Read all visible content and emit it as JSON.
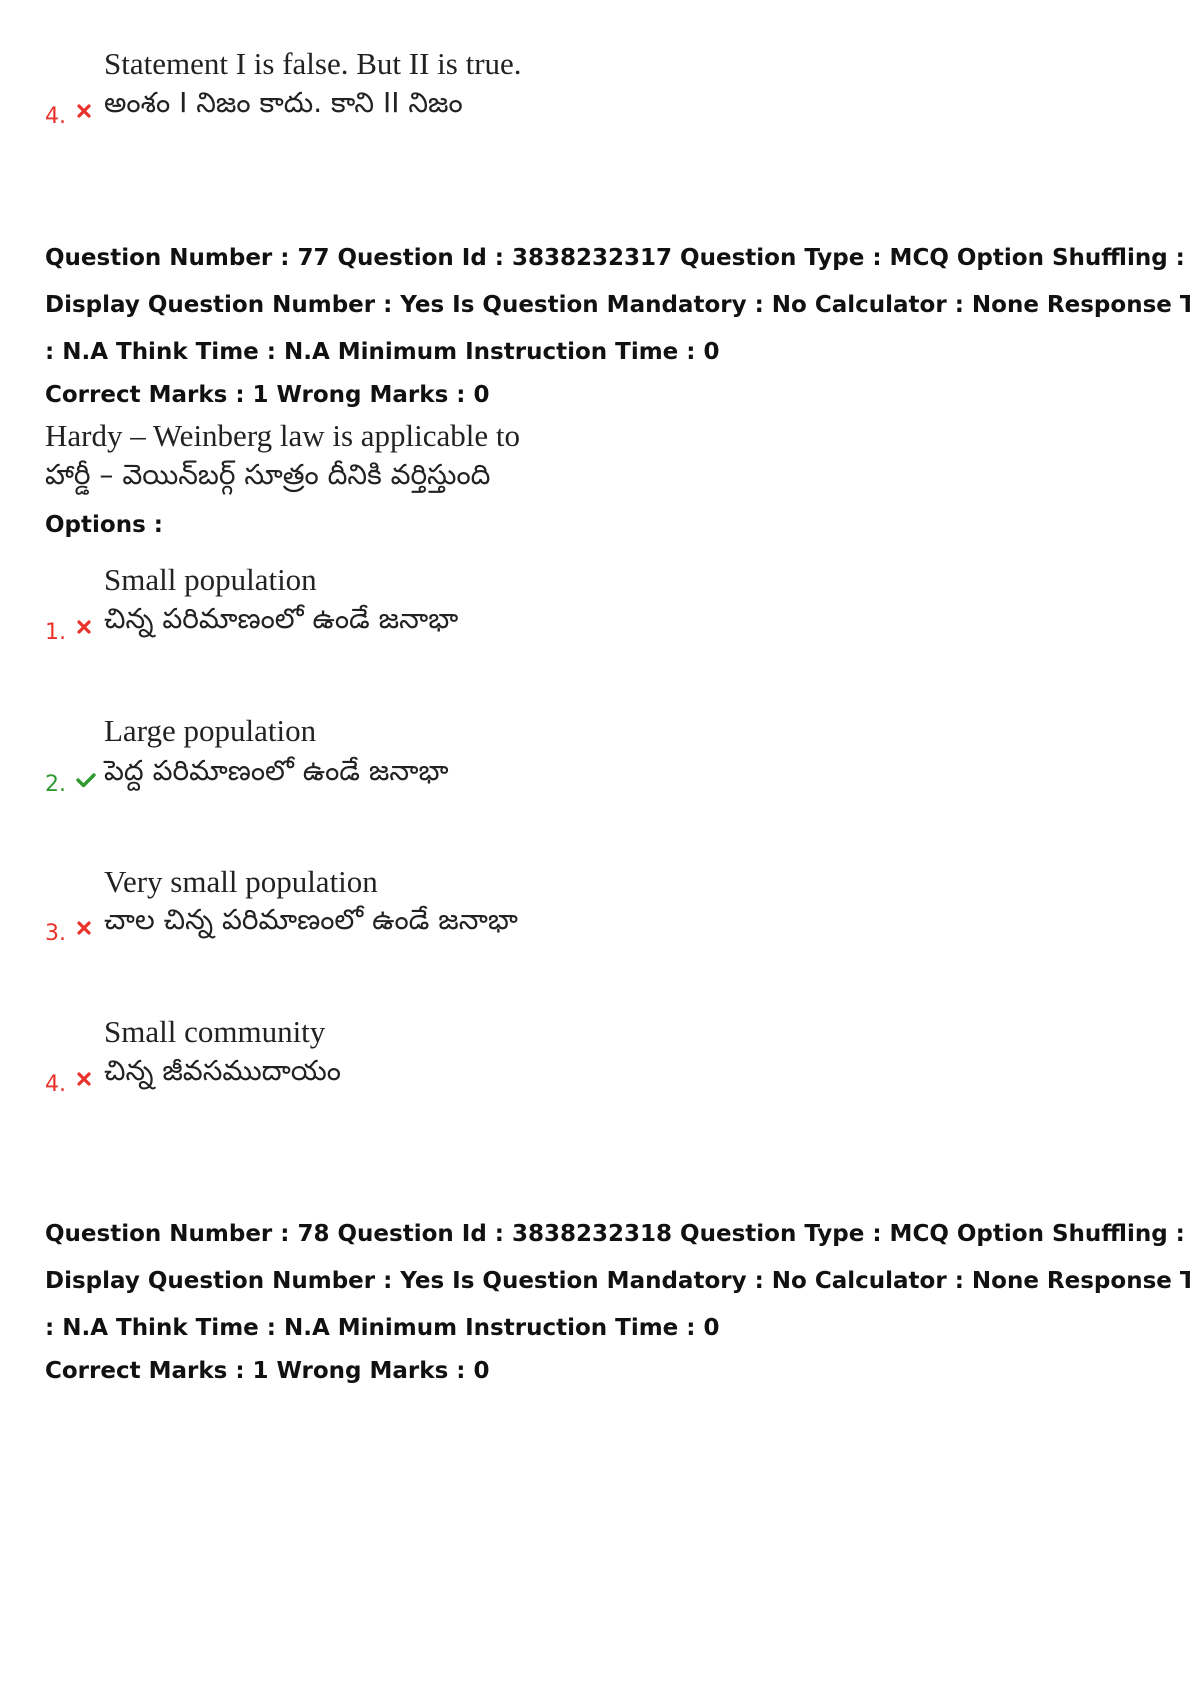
{
  "prev_option": {
    "number": "4.",
    "status": "wrong",
    "english": "Statement I is false. But II is true.",
    "telugu": "అంశం I నిజం కాదు. కాని II నిజం"
  },
  "questions": [
    {
      "meta_lines": [
        "Question Number : 77 Question Id : 3838232317 Question Type : MCQ Option Shuffling : Yes",
        "Display Question Number : Yes Is Question Mandatory : No Calculator : None Response Time",
        ": N.A Think Time : N.A Minimum Instruction Time : 0"
      ],
      "marks": "Correct Marks : 1 Wrong Marks : 0",
      "question_english": "Hardy – Weinberg law is applicable to",
      "question_telugu": "హార్డీ – వెయిన్‌బర్గ్ సూత్రం దీనికి వర్తిస్తుంది",
      "options_label": "Options :",
      "options": [
        {
          "number": "1.",
          "status": "wrong",
          "english": "Small population",
          "telugu": "చిన్న పరిమాణంలో ఉండే జనాభా"
        },
        {
          "number": "2.",
          "status": "correct",
          "english": "Large population",
          "telugu": "పెద్ద పరిమాణంలో ఉండే జనాభా"
        },
        {
          "number": "3.",
          "status": "wrong",
          "english": "Very small population",
          "telugu": "చాల చిన్న పరిమాణంలో ఉండే జనాభా"
        },
        {
          "number": "4.",
          "status": "wrong",
          "english": "Small community",
          "telugu": "చిన్న జీవసముదాయం"
        }
      ]
    },
    {
      "meta_lines": [
        "Question Number : 78 Question Id : 3838232318 Question Type : MCQ Option Shuffling : Yes",
        "Display Question Number : Yes Is Question Mandatory : No Calculator : None Response Time",
        ": N.A Think Time : N.A Minimum Instruction Time : 0"
      ],
      "marks": "Correct Marks : 1 Wrong Marks : 0"
    }
  ],
  "colors": {
    "wrong": "#e8322a",
    "correct": "#2f9a2f"
  }
}
